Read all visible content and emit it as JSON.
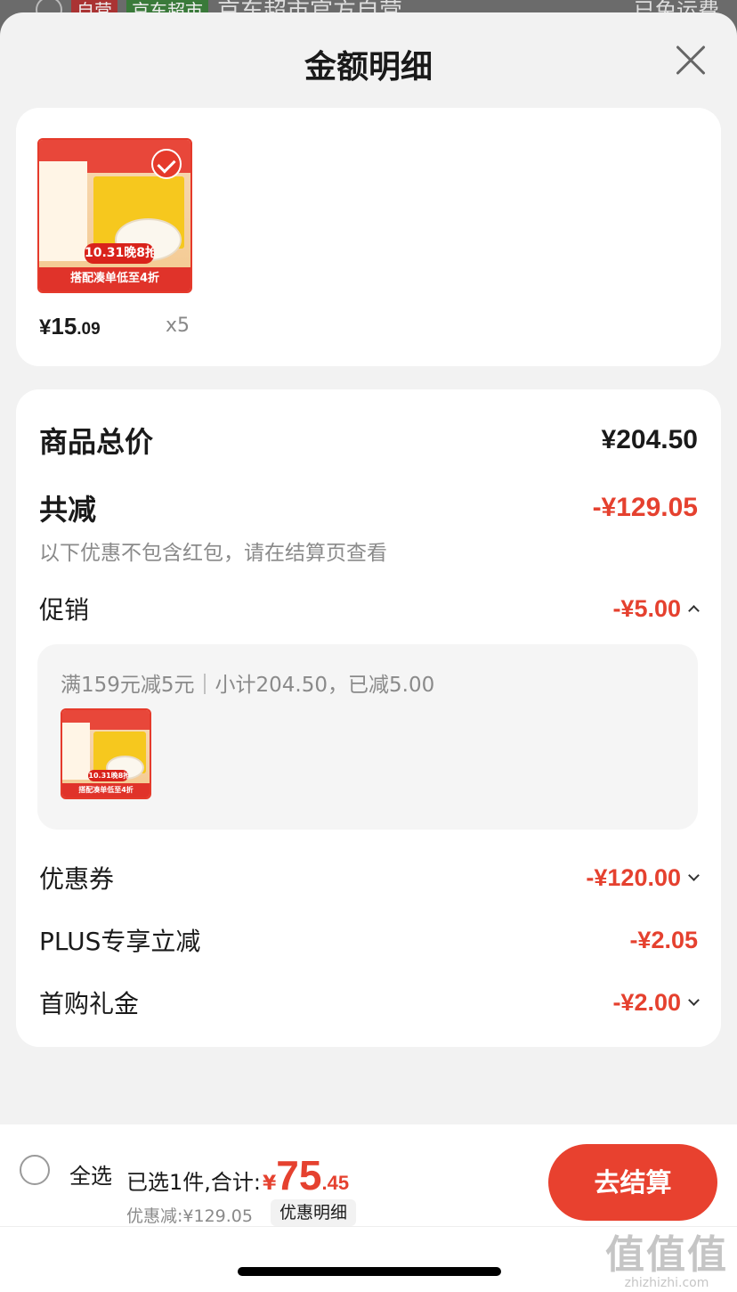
{
  "background": {
    "store_tag": "自营",
    "market_tag": "京东超市",
    "store_name": "京东超市官方自营",
    "shipping": "已免运费"
  },
  "sheet": {
    "title": "金额明细"
  },
  "product": {
    "price_symbol": "¥",
    "price_int": "15",
    "price_dec": ".09",
    "quantity": "x5",
    "badge_text": "10.31晚8抢",
    "banner_text": "搭配凑单低至4折",
    "selected": true
  },
  "summary": {
    "total_label": "商品总价",
    "total_value": "¥204.50",
    "reduce_label": "共减",
    "reduce_value": "-¥129.05",
    "note": "以下优惠不包含红包，请在结算页查看"
  },
  "promotion": {
    "label": "促销",
    "value": "-¥5.00",
    "expanded": true,
    "rule_text": "满159元减5元｜小计204.50，已减5.00"
  },
  "discounts": [
    {
      "label": "优惠券",
      "value": "-¥120.00",
      "has_chevron": true
    },
    {
      "label": "PLUS专享立减",
      "value": "-¥2.05",
      "has_chevron": false
    },
    {
      "label": "首购礼金",
      "value": "-¥2.00",
      "has_chevron": true
    }
  ],
  "bottom_bar": {
    "select_all": "全选",
    "selected_text": "已选1件,合计:",
    "total_symbol": "¥",
    "total_int": "75",
    "total_dec": ".45",
    "saved_text": "优惠减:¥129.05",
    "detail_link": "优惠明细",
    "checkout": "去结算"
  },
  "watermark": {
    "logo": "值值值",
    "url": "zhizhizhi.com"
  },
  "colors": {
    "accent": "#e5412f",
    "button": "#e8412f",
    "card": "#ffffff",
    "sheet_bg": "#f2f2f2"
  }
}
